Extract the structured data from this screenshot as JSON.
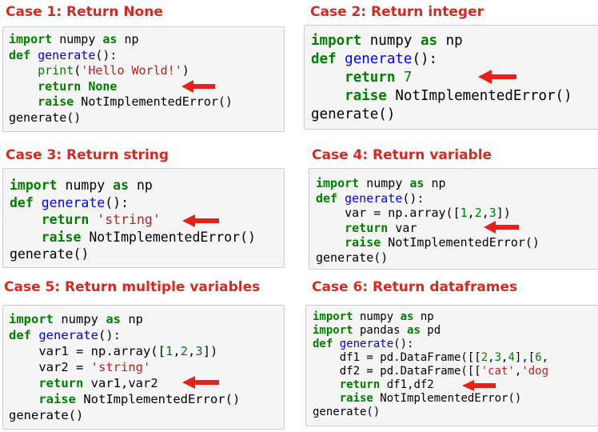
{
  "panels": [
    {
      "title": "Case 1: Return None",
      "lines": [
        [
          {
            "t": "import",
            "c": "kw"
          },
          {
            "t": " numpy "
          },
          {
            "t": "as",
            "c": "kw"
          },
          {
            "t": " np"
          }
        ],
        [
          {
            "t": "def",
            "c": "kw"
          },
          {
            "t": " "
          },
          {
            "t": "generate",
            "c": "fn"
          },
          {
            "t": "():"
          }
        ],
        [
          {
            "t": "    "
          },
          {
            "t": "print",
            "c": "bi"
          },
          {
            "t": "("
          },
          {
            "t": "'Hello World!'",
            "c": "str"
          },
          {
            "t": ")"
          }
        ],
        [
          {
            "t": "    "
          },
          {
            "t": "return",
            "c": "kw"
          },
          {
            "t": " "
          },
          {
            "t": "None",
            "c": "kw"
          }
        ],
        [
          {
            "t": "    "
          },
          {
            "t": "raise",
            "c": "kw"
          },
          {
            "t": " NotImplementedError()"
          }
        ],
        [
          {
            "t": "generate()"
          }
        ]
      ]
    },
    {
      "title": "Case 2: Return integer",
      "lines": [
        [
          {
            "t": "import",
            "c": "kw"
          },
          {
            "t": " numpy "
          },
          {
            "t": "as",
            "c": "kw"
          },
          {
            "t": " np"
          }
        ],
        [
          {
            "t": "def",
            "c": "kw"
          },
          {
            "t": " "
          },
          {
            "t": "generate",
            "c": "fn"
          },
          {
            "t": "():"
          }
        ],
        [
          {
            "t": "    "
          },
          {
            "t": "return",
            "c": "kw"
          },
          {
            "t": " "
          },
          {
            "t": "7",
            "c": "num"
          }
        ],
        [
          {
            "t": "    "
          },
          {
            "t": "raise",
            "c": "kw"
          },
          {
            "t": " NotImplementedError()"
          }
        ],
        [
          {
            "t": "generate()"
          }
        ]
      ]
    },
    {
      "title": "Case 3: Return string",
      "lines": [
        [
          {
            "t": "import",
            "c": "kw"
          },
          {
            "t": " numpy "
          },
          {
            "t": "as",
            "c": "kw"
          },
          {
            "t": " np"
          }
        ],
        [
          {
            "t": "def",
            "c": "kw"
          },
          {
            "t": " "
          },
          {
            "t": "generate",
            "c": "fn"
          },
          {
            "t": "():"
          }
        ],
        [
          {
            "t": "    "
          },
          {
            "t": "return",
            "c": "kw"
          },
          {
            "t": " "
          },
          {
            "t": "'string'",
            "c": "str"
          }
        ],
        [
          {
            "t": "    "
          },
          {
            "t": "raise",
            "c": "kw"
          },
          {
            "t": " NotImplementedError()"
          }
        ],
        [
          {
            "t": "generate()"
          }
        ]
      ]
    },
    {
      "title": "Case 4: Return variable",
      "lines": [
        [
          {
            "t": "import",
            "c": "kw"
          },
          {
            "t": " numpy "
          },
          {
            "t": "as",
            "c": "kw"
          },
          {
            "t": " np"
          }
        ],
        [
          {
            "t": "def",
            "c": "kw"
          },
          {
            "t": " "
          },
          {
            "t": "generate",
            "c": "fn"
          },
          {
            "t": "():"
          }
        ],
        [
          {
            "t": "    var = np.array(["
          },
          {
            "t": "1",
            "c": "num"
          },
          {
            "t": ","
          },
          {
            "t": "2",
            "c": "num"
          },
          {
            "t": ","
          },
          {
            "t": "3",
            "c": "num"
          },
          {
            "t": "])"
          }
        ],
        [
          {
            "t": "    "
          },
          {
            "t": "return",
            "c": "kw"
          },
          {
            "t": " var"
          }
        ],
        [
          {
            "t": "    "
          },
          {
            "t": "raise",
            "c": "kw"
          },
          {
            "t": " NotImplementedError()"
          }
        ],
        [
          {
            "t": "generate()"
          }
        ]
      ]
    },
    {
      "title": "Case 5: Return multiple variables",
      "lines": [
        [
          {
            "t": "import",
            "c": "kw"
          },
          {
            "t": " numpy "
          },
          {
            "t": "as",
            "c": "kw"
          },
          {
            "t": " np"
          }
        ],
        [
          {
            "t": "def",
            "c": "kw"
          },
          {
            "t": " "
          },
          {
            "t": "generate",
            "c": "fn"
          },
          {
            "t": "():"
          }
        ],
        [
          {
            "t": "    var1 = np.array(["
          },
          {
            "t": "1",
            "c": "num"
          },
          {
            "t": ","
          },
          {
            "t": "2",
            "c": "num"
          },
          {
            "t": ","
          },
          {
            "t": "3",
            "c": "num"
          },
          {
            "t": "])"
          }
        ],
        [
          {
            "t": "    var2 = "
          },
          {
            "t": "'string'",
            "c": "str"
          }
        ],
        [
          {
            "t": "    "
          },
          {
            "t": "return",
            "c": "kw"
          },
          {
            "t": " var1,var2"
          }
        ],
        [
          {
            "t": "    "
          },
          {
            "t": "raise",
            "c": "kw"
          },
          {
            "t": " NotImplementedError()"
          }
        ],
        [
          {
            "t": "generate()"
          }
        ]
      ]
    },
    {
      "title": "Case 6: Return dataframes",
      "lines": [
        [
          {
            "t": "import",
            "c": "kw"
          },
          {
            "t": " numpy "
          },
          {
            "t": "as",
            "c": "kw"
          },
          {
            "t": " np"
          }
        ],
        [
          {
            "t": "import",
            "c": "kw"
          },
          {
            "t": " pandas "
          },
          {
            "t": "as",
            "c": "kw"
          },
          {
            "t": " pd"
          }
        ],
        [
          {
            "t": "def",
            "c": "kw"
          },
          {
            "t": " "
          },
          {
            "t": "generate",
            "c": "fn"
          },
          {
            "t": "():"
          }
        ],
        [
          {
            "t": "    df1 = pd.DataFrame([["
          },
          {
            "t": "2",
            "c": "num"
          },
          {
            "t": ","
          },
          {
            "t": "3",
            "c": "num"
          },
          {
            "t": ","
          },
          {
            "t": "4",
            "c": "num"
          },
          {
            "t": "],["
          },
          {
            "t": "6",
            "c": "num"
          },
          {
            "t": ","
          }
        ],
        [
          {
            "t": "    df2 = pd.DataFrame([["
          },
          {
            "t": "'cat'",
            "c": "str"
          },
          {
            "t": ","
          },
          {
            "t": "'dog",
            "c": "str"
          }
        ],
        [
          {
            "t": "    "
          },
          {
            "t": "return",
            "c": "kw"
          },
          {
            "t": " df1,df2"
          }
        ],
        [
          {
            "t": "    "
          },
          {
            "t": "raise",
            "c": "kw"
          },
          {
            "t": " NotImplementedError()"
          }
        ],
        [
          {
            "t": "generate()"
          }
        ]
      ]
    }
  ],
  "colors": {
    "title": "#d42a20",
    "arrow": "#e8201b",
    "keyword": "#008000",
    "function": "#0000ff",
    "string": "#ba2121",
    "code_bg": "#f5f5f5"
  },
  "icons": {
    "pointer": "left-arrow-icon"
  }
}
